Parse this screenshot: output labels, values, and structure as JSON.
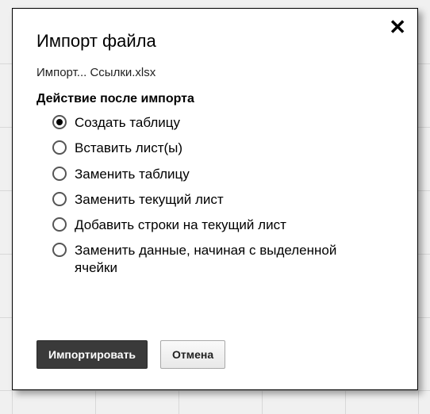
{
  "dialog": {
    "title": "Импорт файла",
    "subtitle": "Импорт... Ссылки.xlsx",
    "section_label": "Действие после импорта",
    "options": [
      {
        "label": "Создать таблицу",
        "selected": true
      },
      {
        "label": "Вставить лист(ы)",
        "selected": false
      },
      {
        "label": "Заменить таблицу",
        "selected": false
      },
      {
        "label": "Заменить текущий лист",
        "selected": false
      },
      {
        "label": "Добавить строки на текущий лист",
        "selected": false
      },
      {
        "label": "Заменить данные, начиная с выделенной ячейки",
        "selected": false
      }
    ],
    "buttons": {
      "import": "Импортировать",
      "cancel": "Отмена"
    },
    "close_glyph": "✕"
  }
}
